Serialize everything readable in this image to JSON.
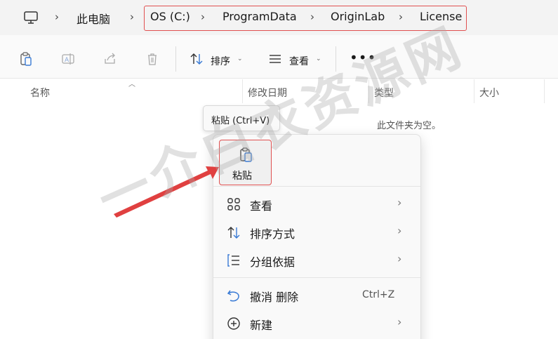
{
  "address_bar": {
    "crumbs": [
      "此电脑",
      "OS (C:)",
      "ProgramData",
      "OriginLab",
      "License"
    ],
    "separator": "›"
  },
  "toolbar": {
    "sort_label": "排序",
    "view_label": "查看",
    "more_label": "•••",
    "chevron": "⌄"
  },
  "columns": {
    "name": "名称",
    "modified": "修改日期",
    "type": "类型",
    "size": "大小"
  },
  "empty_message": "此文件夹为空。",
  "tooltip": "粘贴 (Ctrl+V)",
  "context_menu": {
    "paste_label": "粘贴",
    "items": [
      {
        "label": "查看",
        "icon": "grid-icon",
        "has_submenu": true
      },
      {
        "label": "排序方式",
        "icon": "sort-icon",
        "has_submenu": true
      },
      {
        "label": "分组依据",
        "icon": "group-icon",
        "has_submenu": true
      },
      {
        "label": "撤消 删除",
        "icon": "undo-icon",
        "shortcut": "Ctrl+Z"
      },
      {
        "label": "新建",
        "icon": "add-circle-icon",
        "has_submenu": true
      }
    ],
    "submenu_chevron": "›"
  },
  "watermark": "一介白衣资源网",
  "colors": {
    "highlight_border": "#e05050",
    "arrow": "#e04040",
    "accent_blue": "#3a7bd5"
  }
}
